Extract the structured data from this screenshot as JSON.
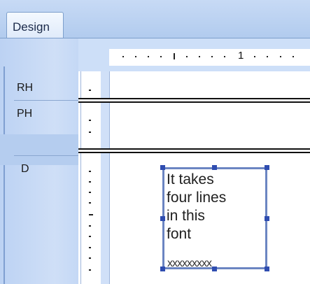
{
  "tabs": {
    "design_label": "Design"
  },
  "ruler": {
    "mark_label": "1"
  },
  "sections": {
    "report_header_label": "RH",
    "page_header_label": "PH",
    "detail_label": "D"
  },
  "text_box": {
    "lines": [
      "It takes",
      "four lines",
      "in this",
      "font"
    ],
    "overflow_marker": "xxxxxxxxx"
  },
  "colors": {
    "band": "#cfdff7",
    "selection_border": "#6b85c2",
    "handle": "#2f4db0"
  }
}
